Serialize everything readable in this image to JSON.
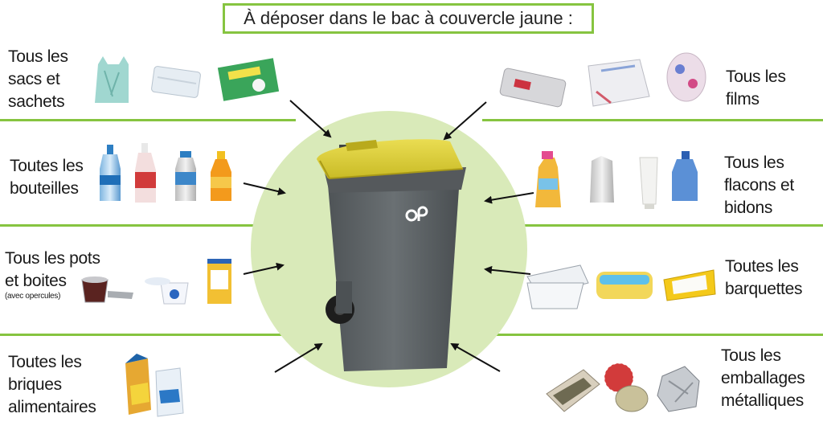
{
  "header": {
    "title": "À déposer dans le bac à couvercle jaune :"
  },
  "bin": {
    "logo": "op",
    "lid_color": "#e3d53a",
    "body_color": "#5f6467",
    "circle_color": "#d9eab9",
    "divider_color": "#86c440"
  },
  "categories": [
    {
      "id": "sacs",
      "lines": [
        "Tous les",
        "sacs et",
        "sachets"
      ]
    },
    {
      "id": "bouteilles",
      "lines": [
        "Toutes les",
        "bouteilles"
      ]
    },
    {
      "id": "pots",
      "lines": [
        "Tous les pots",
        "et boites"
      ],
      "note": "(avec opercules)"
    },
    {
      "id": "briques",
      "lines": [
        "Toutes les",
        "briques",
        "alimentaires"
      ]
    },
    {
      "id": "films",
      "lines": [
        "Tous les",
        "films"
      ]
    },
    {
      "id": "flacons",
      "lines": [
        "Tous les",
        "flacons et",
        "bidons"
      ]
    },
    {
      "id": "barquettes",
      "lines": [
        "Toutes les",
        "barquettes"
      ]
    },
    {
      "id": "metalliques",
      "lines": [
        "Tous les",
        "emballages",
        "métalliques"
      ]
    }
  ]
}
